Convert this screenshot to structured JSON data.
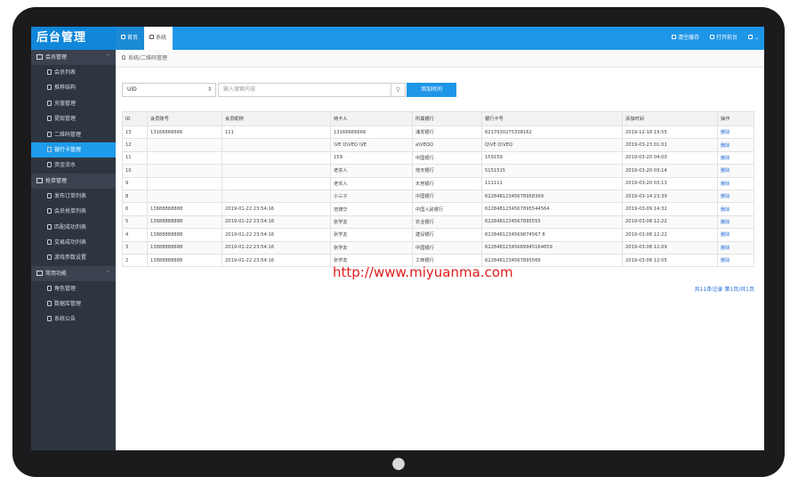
{
  "app": {
    "title": "后台管理"
  },
  "colors": {
    "accent": "#1e96e8",
    "sidebar": "#2f3540",
    "watermark": "#e11b1b"
  },
  "sidebar": {
    "groups": [
      {
        "label": "会员管理",
        "icon": "users-icon",
        "items": [
          {
            "label": "会员列表",
            "icon": "user-icon"
          },
          {
            "label": "推荐结构",
            "icon": "tree-icon"
          },
          {
            "label": "充值管理",
            "icon": "document-icon"
          },
          {
            "label": "提现管理",
            "icon": "document-icon"
          },
          {
            "label": "二维码管理",
            "icon": "document-icon"
          },
          {
            "label": "银行卡管理",
            "icon": "document-icon",
            "active": true
          },
          {
            "label": "资金流水",
            "icon": "document-icon"
          }
        ]
      },
      {
        "label": "抢单管理",
        "icon": "list-icon",
        "items": [
          {
            "label": "发布订单列表",
            "icon": "document-icon"
          },
          {
            "label": "会员抢单列表",
            "icon": "document-icon"
          },
          {
            "label": "匹配成功列表",
            "icon": "document-icon"
          },
          {
            "label": "交易成功列表",
            "icon": "document-icon"
          },
          {
            "label": "游戏参数设置",
            "icon": "document-icon"
          }
        ]
      },
      {
        "label": "常用功能",
        "icon": "tools-icon",
        "items": [
          {
            "label": "角色管理",
            "icon": "user-icon"
          },
          {
            "label": "数据库管理",
            "icon": "lock-icon"
          },
          {
            "label": "系统公告",
            "icon": "notice-icon"
          }
        ]
      }
    ]
  },
  "topbar": {
    "tabs": [
      {
        "label": "首页",
        "icon": "home-icon"
      },
      {
        "label": "系统",
        "icon": "gear-icon"
      }
    ],
    "clear_cache": "清空缓存",
    "open_frontend": "打开前台"
  },
  "breadcrumb": "系统/二维码管理",
  "filter": {
    "select_value": "UID",
    "search_placeholder": "输入搜索内容",
    "add_label": "添加时间"
  },
  "table": {
    "headers": [
      "ID",
      "会员账号",
      "会员昵称",
      "持卡人",
      "所属银行",
      "银行卡号",
      "添加时间",
      "操作"
    ],
    "rows": [
      [
        "13",
        "13166666666",
        "111",
        "13166666666",
        "浦发银行",
        "6217930275338162",
        "2019-12-18 19:55",
        "删除"
      ],
      [
        "12",
        "",
        "",
        "\\VE Q\\VEQ \\VE",
        "a\\VEQQ",
        "Q\\VE Q\\VEQ",
        "2019-03-23 01:01",
        "删除"
      ],
      [
        "11",
        "",
        "",
        "159",
        "中国银行",
        "159159",
        "2019-03-20 04:00",
        "删除"
      ],
      [
        "10",
        "",
        "",
        "老实人",
        "地天银行",
        "5151515",
        "2019-03-20 03:14",
        "删除"
      ],
      [
        "9",
        "",
        "",
        "老实人",
        "天地银行",
        "111111",
        "2019-03-20 03:13",
        "删除"
      ],
      [
        "8",
        "",
        "",
        "小三子",
        "中国银行",
        "62284812345678958369",
        "2019-03-14 23:39",
        "删除"
      ],
      [
        "6",
        "13888888888",
        "2019-01-22 23:54:16",
        "范德华",
        "中国人民银行",
        "6228481234567895544564",
        "2019-03-09 14:32",
        "删除"
      ],
      [
        "5",
        "13888888888",
        "2019-01-22 23:54:16",
        "张学友",
        "农业银行",
        "6228481234567895555",
        "2019-03-08 12:22",
        "删除"
      ],
      [
        "4",
        "13888888888",
        "2019-01-22 23:54:16",
        "张学友",
        "建设银行",
        "6228481234569874567 8",
        "2019-03-08 12:22",
        "删除"
      ],
      [
        "3",
        "13888888888",
        "2019-01-22 23:54:16",
        "张学友",
        "中国银行",
        "62284812345689945164659",
        "2019-03-08 12:09",
        "删除"
      ],
      [
        "2",
        "13888888888",
        "2019-01-22 23:54:16",
        "张学友",
        "工商银行",
        "6228481234567895566",
        "2019-03-08 12:05",
        "删除"
      ]
    ]
  },
  "pager": "共11条记录 第1页/共1页",
  "watermark": "http://www.miyuanma.com"
}
